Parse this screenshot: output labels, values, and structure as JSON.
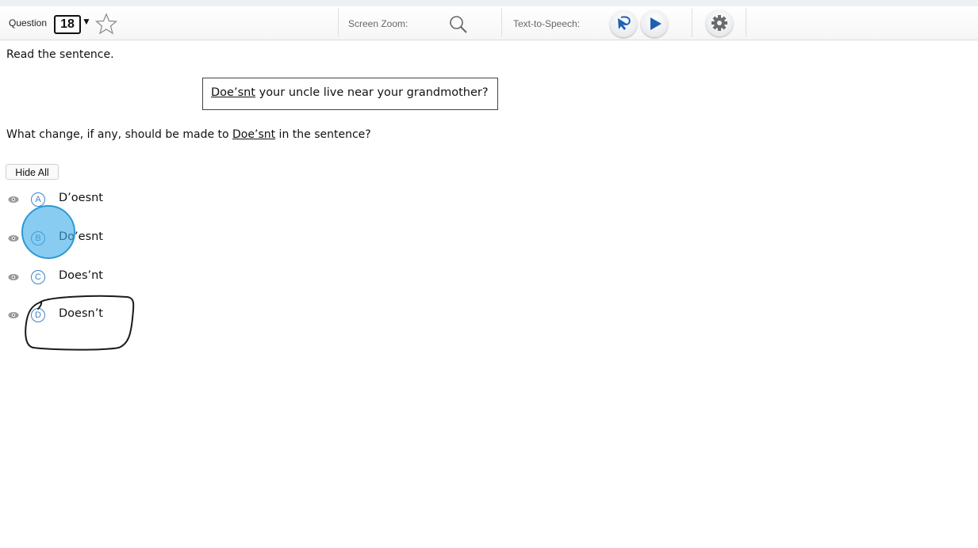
{
  "toolbar": {
    "question_label": "Question",
    "question_number": "18",
    "caret": "▼",
    "screen_zoom_label": "Screen Zoom:",
    "tts_label": "Text-to-Speech:",
    "icons": [
      "star-icon",
      "search-icon",
      "tts-pointer-icon",
      "play-icon",
      "gear-icon"
    ]
  },
  "content": {
    "instruction": "Read the sentence.",
    "sentence": {
      "underlined": "Doe’snt",
      "rest": " your uncle live near your grandmother?"
    },
    "question": {
      "before": "What change, if any, should be made to ",
      "underlined": "Doe’snt",
      "after": " in the sentence?"
    },
    "hide_all_label": "Hide All",
    "options": [
      {
        "letter": "A",
        "text": "D’oesnt"
      },
      {
        "letter": "B",
        "text": "Do’esnt"
      },
      {
        "letter": "C",
        "text": "Does’nt"
      },
      {
        "letter": "D",
        "text": "Doesn’t"
      }
    ]
  },
  "colors": {
    "accent": "#3d84c6",
    "touch_indicator": "#40ace8",
    "tts_blue": "#1f5fb0"
  }
}
